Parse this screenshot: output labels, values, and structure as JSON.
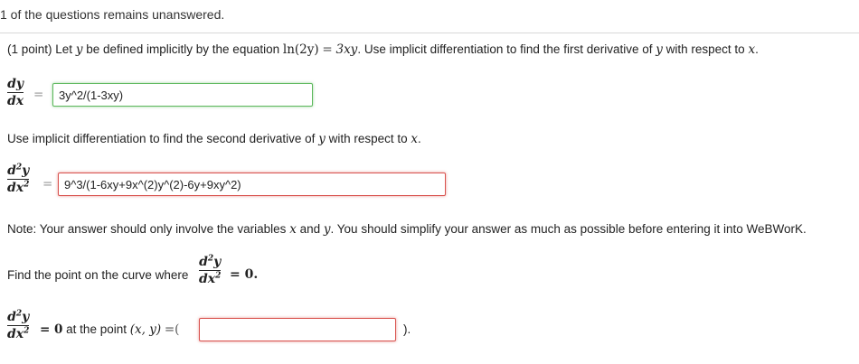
{
  "status": {
    "message": "1 of the questions remains unanswered."
  },
  "problem": {
    "prefix": "(1 point) Let",
    "var_y": "y",
    "defined_text": "be defined implicitly by the equation",
    "equation_lhs": "ln(2y)",
    "equals": "=",
    "equation_rhs": "3xy",
    "instruction": ". Use implicit differentiation to find the first derivative of",
    "wrt_text": "with respect to",
    "var_x": "x",
    "period": "."
  },
  "first_derivative": {
    "num": "dy",
    "den": "dx",
    "answer_value": "3y^2/(1-3xy)",
    "status": "correct"
  },
  "second_intro": {
    "text": "Use implicit differentiation to find the second derivative of",
    "var_y": "y",
    "wrt": "with respect to",
    "var_x": "x",
    "period": "."
  },
  "second_derivative": {
    "num": "d",
    "num_exp": "2",
    "num_var": "y",
    "den": "dx",
    "den_exp": "2",
    "answer_value": "9^3/(1-6xy+9x^(2)y^(2)-6y+9xy^2)",
    "status": "incorrect"
  },
  "note": {
    "prefix": "Note: Your answer should only involve the variables",
    "var_x": "x",
    "and": "and",
    "var_y": "y",
    "suffix": ". You should simplify your answer as much as possible before entering it into WeBWorK."
  },
  "find_point": {
    "text": "Find the point on the curve where",
    "rhs": "= 0."
  },
  "point_answer": {
    "equals_zero": "= 0",
    "at_text": "at the point",
    "point_label": "(x, y)",
    "eq_open": "=(",
    "close": ").",
    "answer_value": "",
    "status": "incorrect"
  }
}
